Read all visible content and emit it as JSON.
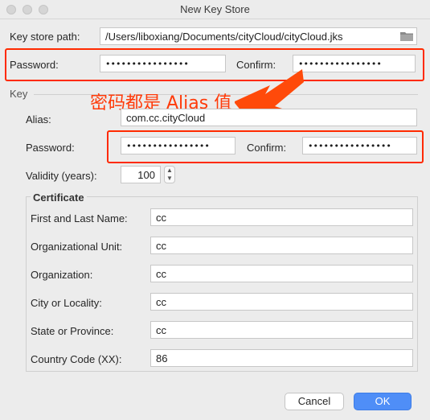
{
  "window": {
    "title": "New Key Store"
  },
  "keystore": {
    "path_label": "Key store path:",
    "path_value": "/Users/liboxiang/Documents/cityCloud/cityCloud.jks",
    "password_label": "Password:",
    "password_value": "••••••••••••••••",
    "confirm_label": "Confirm:",
    "confirm_value": "••••••••••••••••"
  },
  "key": {
    "section_label": "Key",
    "alias_label": "Alias:",
    "alias_value": "com.cc.cityCloud",
    "password_label": "Password:",
    "password_value": "••••••••••••••••",
    "confirm_label": "Confirm:",
    "confirm_value": "••••••••••••••••",
    "validity_label": "Validity (years):",
    "validity_value": "100"
  },
  "certificate": {
    "title": "Certificate",
    "fields": [
      {
        "label": "First and Last Name:",
        "value": "cc"
      },
      {
        "label": "Organizational Unit:",
        "value": "cc"
      },
      {
        "label": "Organization:",
        "value": "cc"
      },
      {
        "label": "City or Locality:",
        "value": "cc"
      },
      {
        "label": "State or Province:",
        "value": "cc"
      },
      {
        "label": "Country Code (XX):",
        "value": "86"
      }
    ]
  },
  "annotation": {
    "text": "密码都是 Alias 值",
    "color": "#ff3b0a"
  },
  "buttons": {
    "cancel": "Cancel",
    "ok": "OK"
  },
  "colors": {
    "accent": "#4f8ef7",
    "highlight": "#ff2a00"
  },
  "icons": {
    "browse": "folder-icon",
    "spinner_up": "chevron-up-icon",
    "spinner_down": "chevron-down-icon"
  }
}
